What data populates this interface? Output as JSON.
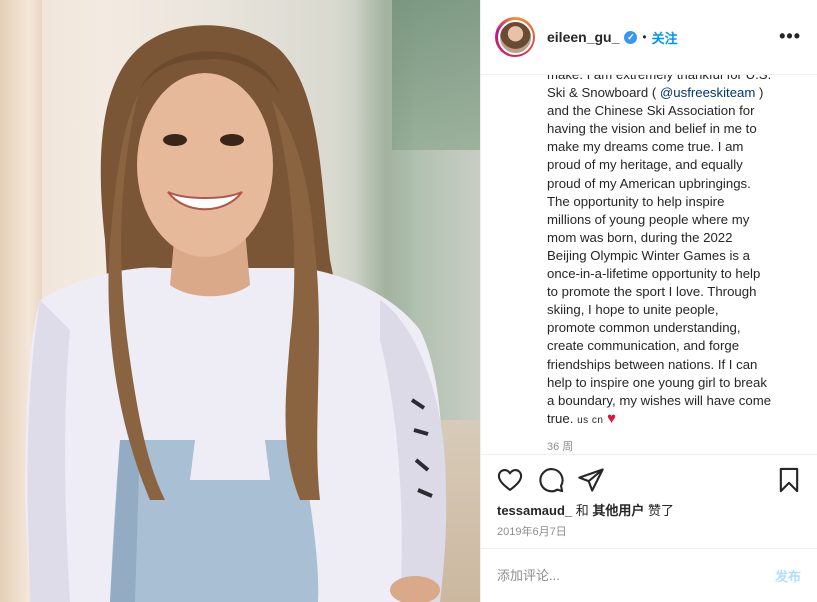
{
  "post": {
    "username": "eileen_gu_",
    "verified_mark": "✓",
    "separator": "•",
    "follow_label": "关注",
    "more_label": "•••",
    "photo_alt": "Photo of a smiling young woman with long hair wearing a white long-sleeve shirt and denim overalls, leaning against a wall"
  },
  "caption": {
    "l1": "make. I am extremely thankful for U.S.",
    "l2a": "Ski & Snowboard ( ",
    "l2_mention": "@usfreeskiteam",
    "l2b": " )",
    "l3": "and the Chinese Ski Association for",
    "l4": "having the vision and belief in me to",
    "l5": "make my dreams come true. I am",
    "l6": "proud of my heritage, and equally",
    "l7": "proud of my American upbringings.",
    "l8": "The opportunity to help inspire",
    "l9": "millions of young people where my",
    "l10": "mom was born, during the 2022",
    "l11": "Beijing Olympic Winter Games is a",
    "l12": "once-in-a-lifetime opportunity to help",
    "l13": "to promote the sport I love. Through",
    "l14": "skiing, I hope to unite people,",
    "l15": "promote common understanding,",
    "l16": "create communication, and forge",
    "l17": "friendships between nations. If I can",
    "l18": "help to inspire one young girl to break",
    "l19": "a boundary, my wishes will have come",
    "l20": "true. ",
    "flags": "us cn",
    "heart": "♥",
    "meta": "36 周"
  },
  "likes": {
    "user": "tessamaud_",
    "and": " 和 ",
    "others": "其他用户",
    "liked": " 赞了"
  },
  "date": "2019年6月7日",
  "comment": {
    "placeholder": "添加评论...",
    "post_label": "发布"
  },
  "colors": {
    "accent": "#0095f6",
    "heart": "#e0163c",
    "muted": "#8e8e8e",
    "post_disabled": "#b2dffc"
  }
}
